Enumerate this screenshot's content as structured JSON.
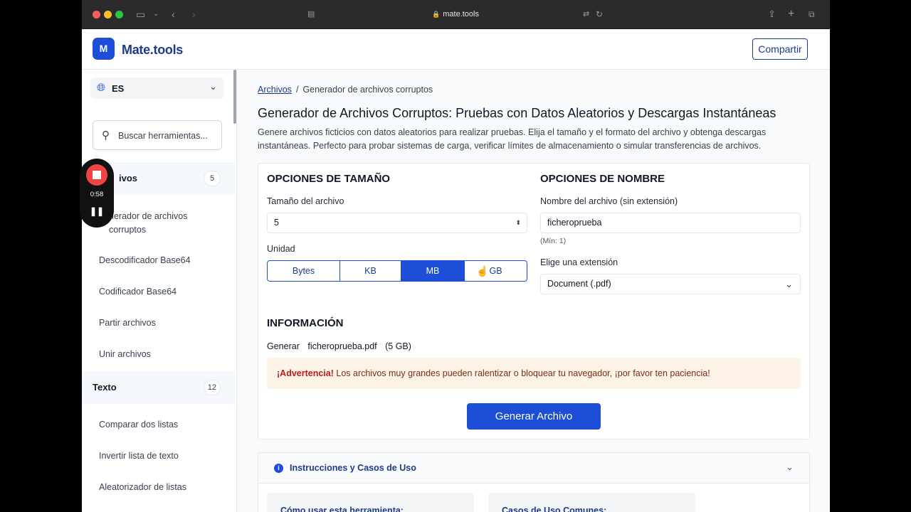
{
  "browser": {
    "url": "mate.tools"
  },
  "header": {
    "logo_letter": "M",
    "logo_text": "Mate.tools",
    "share_label": "Compartir"
  },
  "sidebar": {
    "language": "ES",
    "search_placeholder": "Buscar herramientas...",
    "categories": [
      {
        "label": "Archivos",
        "visible_label": "ivos",
        "count": "5",
        "items": [
          "nerador de archivos corruptos",
          "Descodificador Base64",
          "Codificador Base64",
          "Partir archivos",
          "Unir archivos"
        ]
      },
      {
        "label": "Texto",
        "count": "12",
        "items": [
          "Comparar dos listas",
          "Invertir lista de texto",
          "Aleatorizador de listas"
        ]
      }
    ]
  },
  "recording": {
    "time": "0:58"
  },
  "main": {
    "breadcrumb": {
      "link": "Archivos",
      "separator": "/",
      "current": "Generador de archivos corruptos"
    },
    "title": "Generador de Archivos Corruptos: Pruebas con Datos Aleatorios y Descargas Instantáneas",
    "description": "Genere archivos ficticios con datos aleatorios para realizar pruebas. Elija el tamaño y el formato del archivo y obtenga descargas instantáneas. Perfecto para probar sistemas de carga, verificar límites de almacenamiento o simular transferencias de archivos.",
    "size": {
      "title": "OPCIONES DE TAMAÑO",
      "size_label": "Tamaño del archivo",
      "size_value": "5",
      "unit_label": "Unidad",
      "units": [
        "Bytes",
        "KB",
        "MB",
        "GB"
      ],
      "selected_unit": "MB"
    },
    "name": {
      "title": "OPCIONES DE NOMBRE",
      "name_label": "Nombre del archivo (sin extensión)",
      "name_value": "ficheroprueba",
      "min_hint": "(Mín: 1)",
      "ext_label": "Elige una extensión",
      "ext_value": "Document (.pdf)"
    },
    "info": {
      "title": "INFORMACIÓN",
      "generate_word": "Generar",
      "filename": "ficheroprueba.pdf",
      "size": "(5 GB)",
      "warning_strong": "¡Advertencia!",
      "warning_text": " Los archivos muy grandes pueden ralentizar o bloquear tu navegador, ¡por favor ten paciencia!"
    },
    "generate_button": "Generar Archivo",
    "accordion": {
      "title": "Instrucciones y Casos de Uso",
      "left_title": "Cómo usar esta herramienta:",
      "right_title": "Casos de Uso Comunes:"
    }
  },
  "colors": {
    "accent": "#1d4ed8",
    "brand_text": "#1e3a8a",
    "warning_bg": "#fef3e7",
    "record": "#ef4444"
  }
}
